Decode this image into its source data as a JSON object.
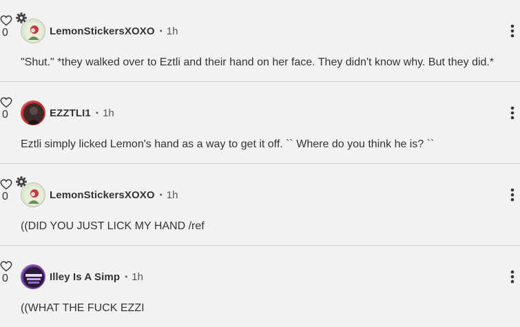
{
  "comments": [
    {
      "username": "LemonStickersXOXO",
      "time": "1h",
      "text": "\"Shut.\" *they walked over to Eztli and their hand on her face. They didn't know why. But they did.*",
      "likes": "0",
      "has_gear": true,
      "avatar": "lemon-avatar-icon"
    },
    {
      "username": "EZZTLI1",
      "time": "1h",
      "text": "Eztli simply licked Lemon's hand as a way to get it off. `` Where do you think he is? ``",
      "likes": "0",
      "has_gear": false,
      "avatar": "eztli-avatar-icon"
    },
    {
      "username": "LemonStickersXOXO",
      "time": "1h",
      "text": "((DID YOU JUST LICK MY HAND /ref",
      "likes": "0",
      "has_gear": true,
      "avatar": "lemon-avatar-icon"
    },
    {
      "username": "Illey Is A Simp",
      "time": "1h",
      "text": "((WHAT THE FUCK EZZI",
      "likes": "0",
      "has_gear": false,
      "avatar": "illey-avatar-icon"
    }
  ],
  "separator": "•",
  "icons": {
    "like": "heart-outline-icon",
    "menu": "more-vertical-icon",
    "gear": "gear-icon"
  }
}
